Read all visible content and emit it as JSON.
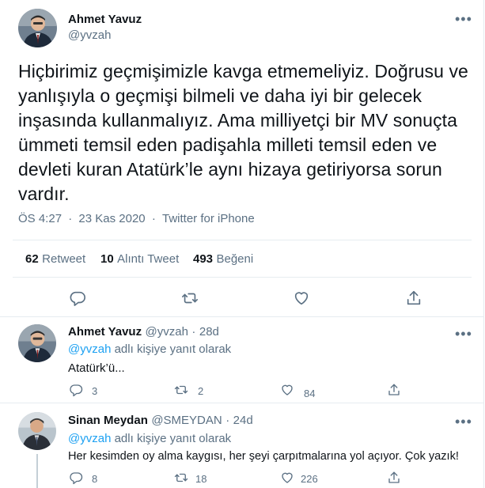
{
  "main_tweet": {
    "author_name": "Ahmet Yavuz",
    "author_handle": "@yvzah",
    "text": "Hiçbirimiz geçmişimizle kavga etmemeliyiz. Doğrusu ve yanlışıyla o geçmişi bilmeli ve daha iyi bir gelecek inşasında kullanmalıyız. Ama milliyetçi bir MV sonuçta ümmeti temsil eden padişahla milleti temsil eden ve devleti kuran Atatürk’le aynı hizaya getiriyorsa sorun vardır.",
    "time": "ÖS 4:27",
    "separator": "·",
    "date": "23 Kas 2020",
    "source": "Twitter for iPhone",
    "stats": {
      "retweets": "62",
      "retweets_label": "Retweet",
      "quotes": "10",
      "quotes_label": "Alıntı Tweet",
      "likes": "493",
      "likes_label": "Beğeni"
    }
  },
  "replies": [
    {
      "author_name": "Ahmet Yavuz",
      "author_handle": "@yvzah",
      "separator": "·",
      "age": "28d",
      "reply_to_handle": "@yvzah",
      "reply_to_suffix": "adlı kişiye yanıt olarak",
      "text": "Atatürk’ü...",
      "reply_count": "3",
      "retweet_count": "2",
      "like_count": "84"
    },
    {
      "author_name": "Sinan Meydan",
      "author_handle": "@SMEYDAN",
      "separator": "·",
      "age": "24d",
      "reply_to_handle": "@yvzah",
      "reply_to_suffix": "adlı kişiye yanıt olarak",
      "text": "Her kesimden oy alma kaygısı, her şeyi çarpıtmalarına yol açıyor. Çok yazık!",
      "reply_count": "8",
      "retweet_count": "18",
      "like_count": "226"
    }
  ],
  "icons": {
    "more": "more-icon",
    "reply": "reply-icon",
    "retweet": "retweet-icon",
    "like": "heart-icon",
    "share": "share-icon"
  },
  "more_glyph": "•••",
  "colors": {
    "link": "#1da1f2",
    "secondary_text": "#5b7083",
    "primary_text": "#0f1419",
    "border": "#e6ecf0"
  }
}
